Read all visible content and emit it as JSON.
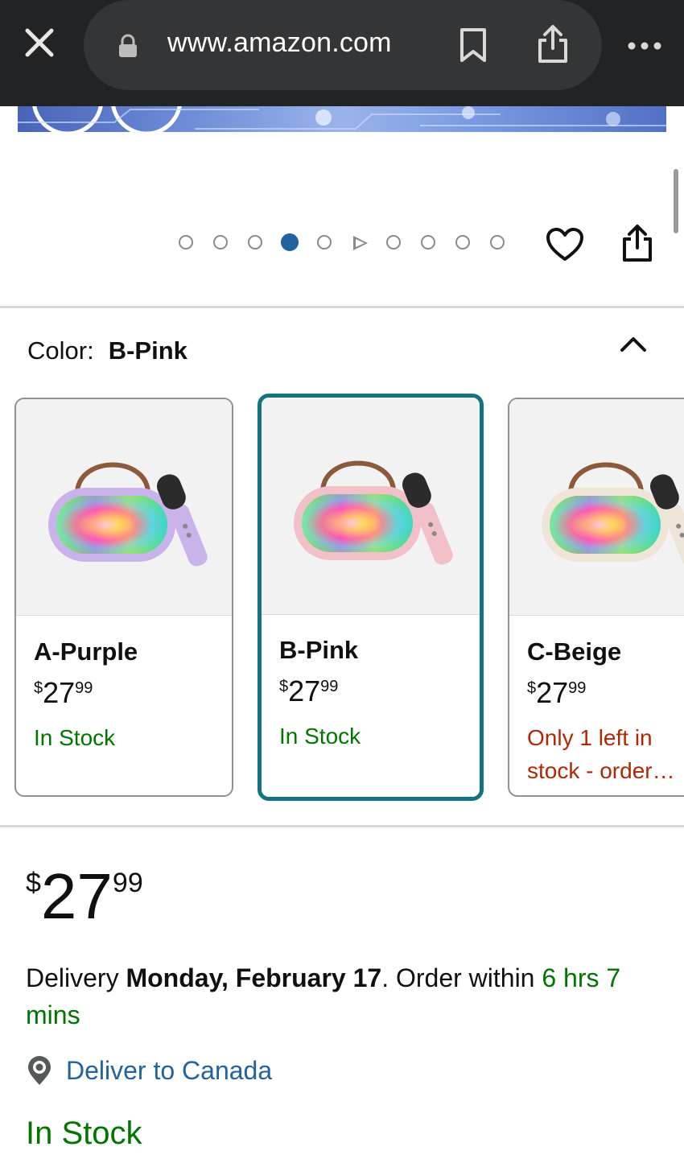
{
  "browser": {
    "url": "www.amazon.com"
  },
  "carousel": {
    "total_dots": 10,
    "active_index": 3,
    "video_index": 5
  },
  "variation": {
    "label": "Color:",
    "selected": "B-Pink",
    "options": [
      {
        "name": "A-Purple",
        "currency": "$",
        "whole": "27",
        "fraction": "99",
        "stock": "In Stock",
        "stock_status": "in",
        "body_color": "#c9b3ea"
      },
      {
        "name": "B-Pink",
        "currency": "$",
        "whole": "27",
        "fraction": "99",
        "stock": "In Stock",
        "stock_status": "in",
        "body_color": "#f2c0c8"
      },
      {
        "name": "C-Beige",
        "currency": "$",
        "whole": "27",
        "fraction": "99",
        "stock": "Only 1 left in stock - order…",
        "stock_status": "low",
        "body_color": "#efe4d8"
      }
    ]
  },
  "price": {
    "currency": "$",
    "whole": "27",
    "fraction": "99"
  },
  "delivery": {
    "prefix": "Delivery ",
    "date": "Monday, February 17",
    "middle": ". Order within ",
    "countdown": "6 hrs 7 mins"
  },
  "deliver_to": "Deliver to Canada",
  "availability": "In Stock",
  "colors": {
    "link": "#2162a1",
    "in_stock": "#007600",
    "low_stock": "#b12704",
    "selected_border": "#137481"
  }
}
